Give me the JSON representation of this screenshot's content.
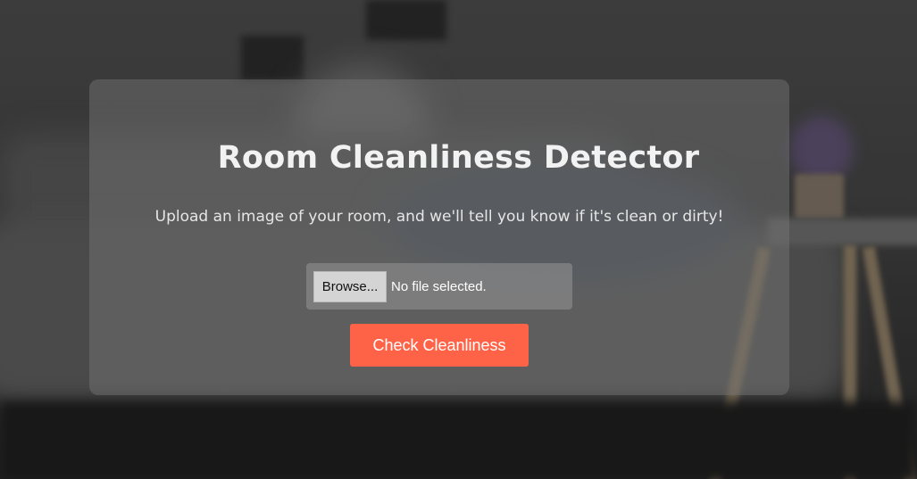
{
  "page": {
    "title": "Room Cleanliness Detector",
    "subtitle": "Upload an image of your room, and we'll tell you know if it's clean or dirty!"
  },
  "upload": {
    "browse_label": "Browse...",
    "status_text": "No file selected."
  },
  "actions": {
    "check_label": "Check Cleanliness"
  },
  "colors": {
    "accent": "#ff6347",
    "card_overlay": "rgba(120,120,120,0.45)"
  }
}
